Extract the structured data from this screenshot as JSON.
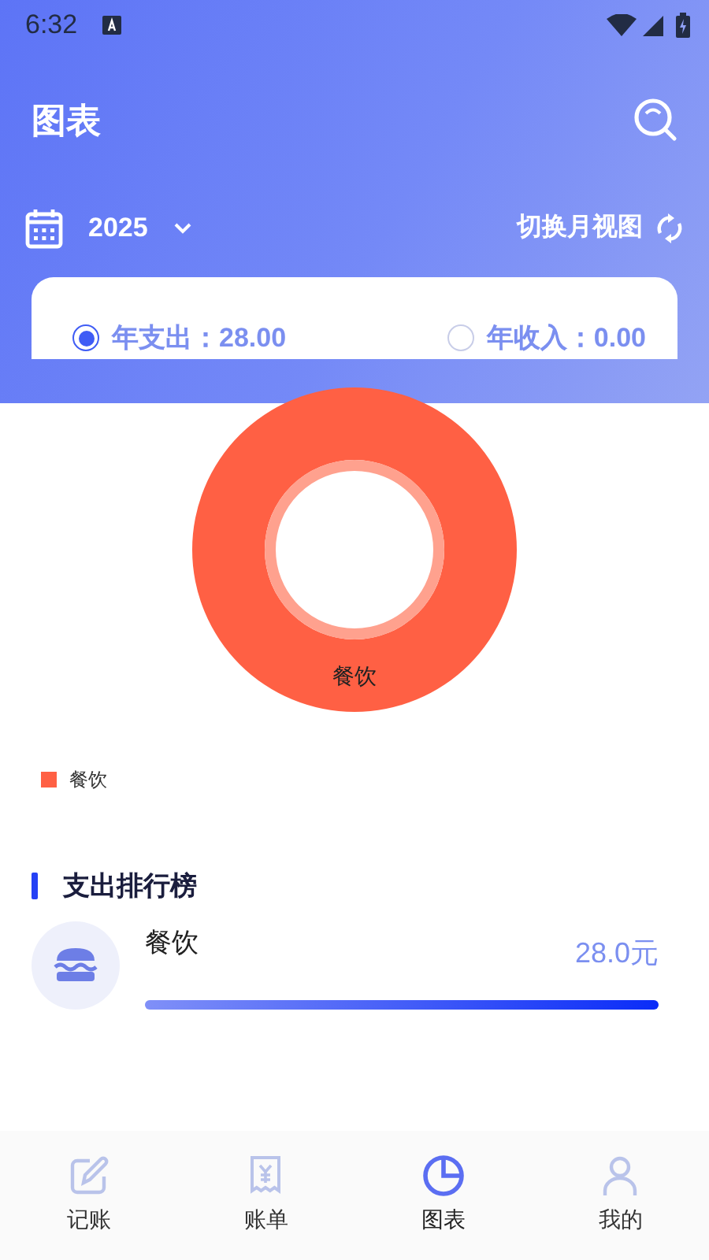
{
  "status_bar": {
    "time": "6:32"
  },
  "header": {
    "title": "图表",
    "year": "2025",
    "switch_label": "切换月视图"
  },
  "totals": [
    {
      "label": "年支出：28.00",
      "selected": true
    },
    {
      "label": "年收入：0.00",
      "selected": false
    }
  ],
  "chart": {
    "slice_labels": [
      "餐饮"
    ],
    "legend": [
      {
        "label": "餐饮",
        "color": "#ff6044"
      }
    ]
  },
  "ranking": {
    "title": "支出排行榜",
    "items": [
      {
        "name": "餐饮",
        "amount": "28.0元",
        "level": 1
      }
    ]
  },
  "nav": [
    {
      "label": "记账",
      "kind": "pencil",
      "selected": false
    },
    {
      "label": "账单",
      "kind": "receipt",
      "selected": false
    },
    {
      "label": "图表",
      "kind": "pie",
      "selected": true
    },
    {
      "label": "我的",
      "kind": "person",
      "selected": false
    }
  ]
}
